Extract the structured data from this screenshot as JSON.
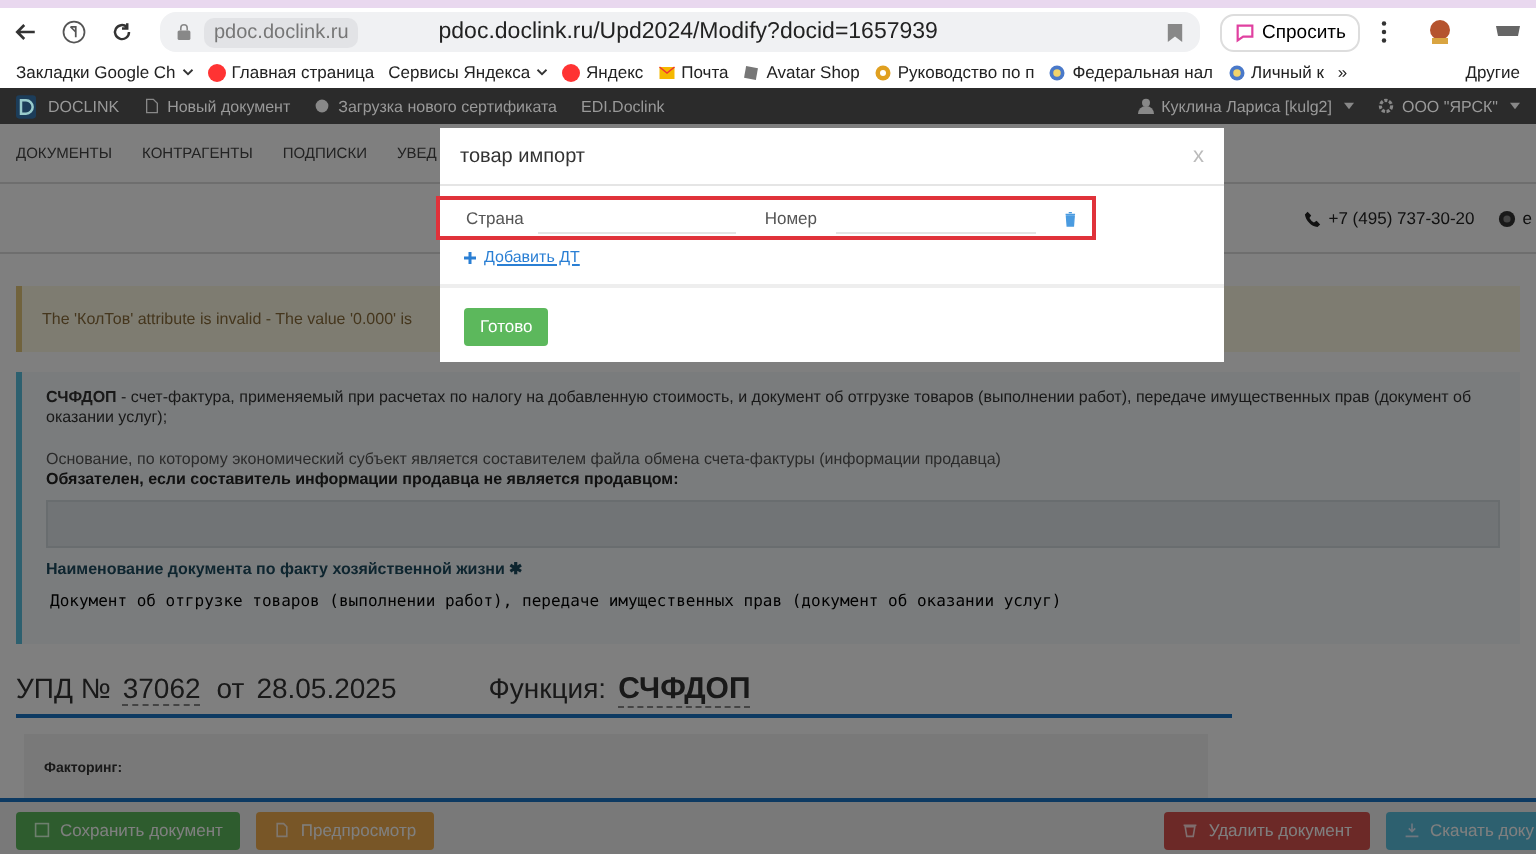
{
  "browser": {
    "site_chip": "pdoc.doclink.ru",
    "url": "pdoc.doclink.ru/Upd2024/Modify?docid=1657939",
    "ask_button": "Спросить",
    "bookmarks": [
      {
        "label": "Закладки Google Ch",
        "kind": "plain",
        "caret": true
      },
      {
        "label": "Главная страница",
        "kind": "yandex",
        "caret": false
      },
      {
        "label": "Сервисы Яндекса",
        "kind": "plain",
        "caret": true
      },
      {
        "label": "Яндекс",
        "kind": "yandex",
        "caret": false
      },
      {
        "label": "Почта",
        "kind": "mail",
        "caret": false
      },
      {
        "label": "Avatar Shop",
        "kind": "square",
        "caret": false
      },
      {
        "label": "Руководство по п",
        "kind": "gear",
        "caret": false
      },
      {
        "label": "Федеральная нал",
        "kind": "globe",
        "caret": false
      },
      {
        "label": "Личный к",
        "kind": "globe",
        "caret": false
      }
    ],
    "more": "»",
    "other": "Другие"
  },
  "navbar": {
    "brand": "DOCLINK",
    "links": [
      {
        "label": "Новый документ",
        "kind": "doc"
      },
      {
        "label": "Загрузка нового сертификата",
        "kind": "cert"
      },
      {
        "label": "EDI.Doclink",
        "kind": "plain"
      }
    ],
    "user": "Куклина Лариса [kulg2]",
    "org": "ООО \"ЯРСК\""
  },
  "menu": [
    "ДОКУМЕНТЫ",
    "КОНТРАГЕНТЫ",
    "ПОДПИСКИ",
    "УВЕД"
  ],
  "contact": {
    "phone": "+7 (495) 737-30-20",
    "extra": "e"
  },
  "warning": "The 'КолТов' attribute is invalid - The value '0.000' is",
  "info": {
    "description": "**СЧФДОП** - счет-фактура, применяемый при расчетах по налогу на добавленную стоимость, и документ об отгрузке товаров (выполнении работ), передаче имущественных прав (документ об оказании услуг);",
    "basis": "Основание, по которому экономический субъект является составителем файла обмена счета-фактуры (информации продавца)",
    "basis_note": "Обязателен, если составитель информации продавца не является продавцом:",
    "doc_name_label": "Наименование документа по факту хозяйственной жизни",
    "required_mark": "✱",
    "doc_name_value": "Документ об отгрузке товаров (выполнении работ), передаче имущественных прав (документ об оказании услуг)"
  },
  "heading": {
    "prefix": "УПД №",
    "number": "37062",
    "from": "от",
    "date": "28.05.2025",
    "function_label": "Функция:",
    "function_value": "СЧФДОП"
  },
  "factoring_label": "Факторинг:",
  "left_actions": [
    {
      "label": "Сохранить документ",
      "kind": "save"
    },
    {
      "label": "Предпросмотр",
      "kind": "preview"
    }
  ],
  "right_actions": [
    {
      "label": "Удалить документ",
      "kind": "delete"
    },
    {
      "label": "Скачать доку",
      "kind": "download"
    }
  ],
  "modal": {
    "title": "товар импорт",
    "close": "x",
    "fields": [
      {
        "label": "Страна"
      },
      {
        "label": "Номер"
      }
    ],
    "add_link": "Добавить ДТ",
    "done_button": "Готово"
  }
}
